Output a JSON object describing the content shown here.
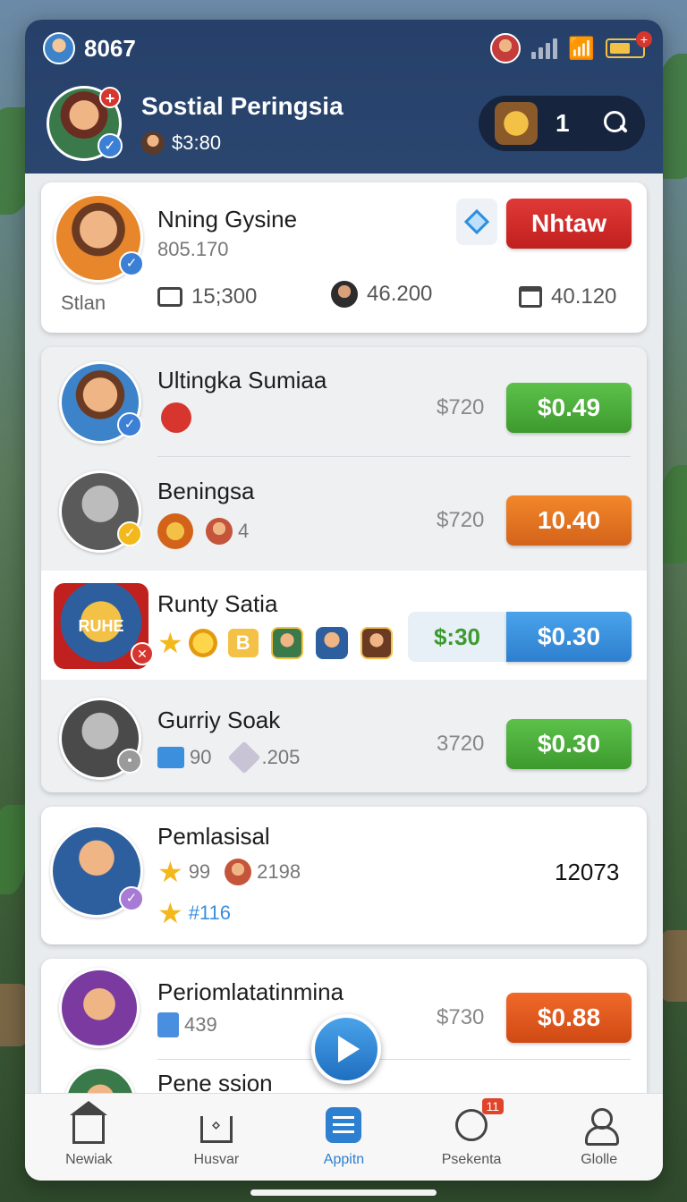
{
  "status_bar": {
    "coins": "8067"
  },
  "profile": {
    "name": "Sostial Peringsia",
    "money": "$3:80",
    "plus_badge": "+",
    "check_badge": "✓"
  },
  "search": {
    "count": "1"
  },
  "featured": {
    "title": "Nning Gysine",
    "subtitle": "805.170",
    "label": "Stlan",
    "action_label": "Nhtaw",
    "stats": [
      "15;300",
      "46.200",
      "40.120"
    ],
    "check_badge": "✓"
  },
  "rows": [
    {
      "title": "Ultingka Sumiaa",
      "price": "$720",
      "button": "$0.49",
      "badge": "✓"
    },
    {
      "title": "Beningsa",
      "price": "$720",
      "button": "10.40",
      "extra": "4",
      "badge": "✓"
    },
    {
      "title": "Runty Satia",
      "split_left": "$:30",
      "button": "$0.30",
      "chip_letter": "B",
      "emblem_text": "RUHE",
      "badge": "✕"
    },
    {
      "title": "Gurriy Soak",
      "price": "3720",
      "button": "$0.30",
      "stats": [
        "90",
        ".205"
      ],
      "badge": "•"
    }
  ],
  "card_pemlasisal": {
    "title": "Pemlasisal",
    "line1_a": "99",
    "line1_b": "2198",
    "line2": "#116",
    "value": "12073",
    "badge": "✓"
  },
  "card_last": {
    "title": "Periomlatatinmina",
    "stat": "439",
    "price": "$730",
    "button": "$0.88",
    "second_title": "Pene ssion"
  },
  "tabs": [
    {
      "label": "Newiak"
    },
    {
      "label": "Husvar"
    },
    {
      "label": "Appitn"
    },
    {
      "label": "Psekenta",
      "badge": "11"
    },
    {
      "label": "Glolle"
    }
  ],
  "icons": {
    "star": "★",
    "wifi": "📶",
    "battery_plus": "+"
  },
  "colors": {
    "header": "#26406a",
    "green": "#3d9a2e",
    "orange": "#d4631a",
    "red": "#c0201e",
    "blue": "#2d7fcf"
  }
}
